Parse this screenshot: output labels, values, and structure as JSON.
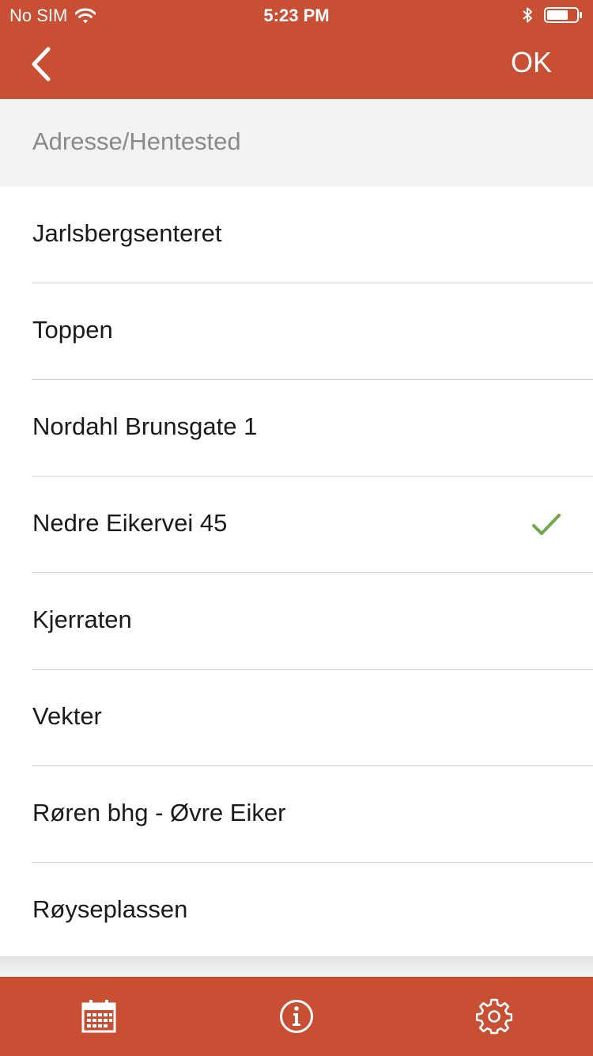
{
  "status_bar": {
    "carrier": "No SIM",
    "time": "5:23 PM"
  },
  "nav": {
    "back_icon": "chevron-left-icon",
    "ok_label": "OK"
  },
  "section_header": "Adresse/Hentested",
  "items": [
    {
      "label": "Jarlsbergsenteret",
      "selected": false
    },
    {
      "label": "Toppen",
      "selected": false
    },
    {
      "label": "Nordahl Brunsgate 1",
      "selected": false
    },
    {
      "label": "Nedre Eikervei 45",
      "selected": true
    },
    {
      "label": "Kjerraten",
      "selected": false
    },
    {
      "label": "Vekter",
      "selected": false
    },
    {
      "label": "Røren bhg - Øvre Eiker",
      "selected": false
    },
    {
      "label": "Røyseplassen",
      "selected": false
    }
  ],
  "tabs": [
    {
      "icon": "calendar-icon"
    },
    {
      "icon": "info-icon"
    },
    {
      "icon": "settings-gear-icon"
    }
  ],
  "colors": {
    "brand": "#c84f33",
    "check": "#6fa84a",
    "section_bg": "#f2f2f2"
  }
}
